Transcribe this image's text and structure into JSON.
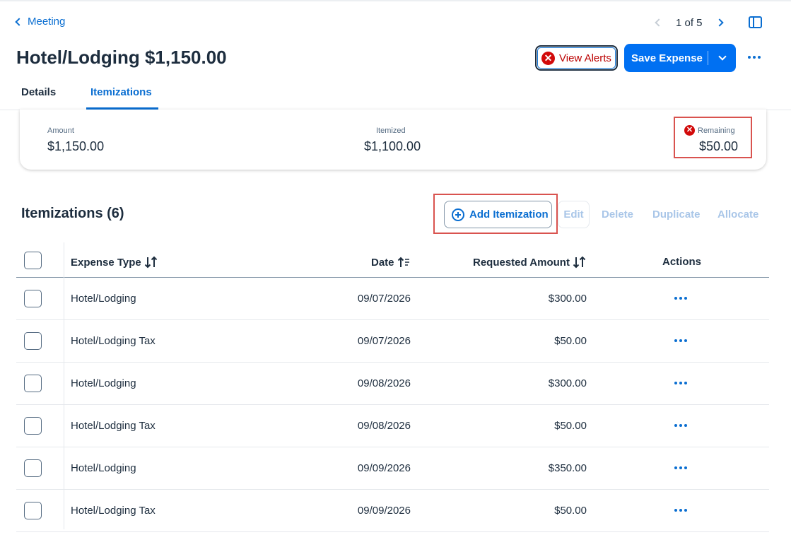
{
  "header": {
    "back_label": "Meeting",
    "pager_text": "1 of 5",
    "title": "Hotel/Lodging $1,150.00",
    "view_alerts_label": "View Alerts",
    "save_label": "Save Expense"
  },
  "tabs": [
    {
      "label": "Details",
      "active": false
    },
    {
      "label": "Itemizations",
      "active": true
    }
  ],
  "summary": {
    "amount_label": "Amount",
    "amount_value": "$1,150.00",
    "itemized_label": "Itemized",
    "itemized_value": "$1,100.00",
    "remaining_label": "Remaining",
    "remaining_value": "$50.00"
  },
  "itemizations": {
    "title": "Itemizations (6)",
    "add_label": "Add Itemization",
    "edit_label": "Edit",
    "delete_label": "Delete",
    "duplicate_label": "Duplicate",
    "allocate_label": "Allocate"
  },
  "table": {
    "columns": {
      "expense_type": "Expense Type",
      "date": "Date",
      "requested_amount": "Requested Amount",
      "actions": "Actions"
    },
    "rows": [
      {
        "expense_type": "Hotel/Lodging",
        "date": "09/07/2026",
        "amount": "$300.00"
      },
      {
        "expense_type": "Hotel/Lodging Tax",
        "date": "09/07/2026",
        "amount": "$50.00"
      },
      {
        "expense_type": "Hotel/Lodging",
        "date": "09/08/2026",
        "amount": "$300.00"
      },
      {
        "expense_type": "Hotel/Lodging Tax",
        "date": "09/08/2026",
        "amount": "$50.00"
      },
      {
        "expense_type": "Hotel/Lodging",
        "date": "09/09/2026",
        "amount": "$350.00"
      },
      {
        "expense_type": "Hotel/Lodging Tax",
        "date": "09/09/2026",
        "amount": "$50.00"
      }
    ]
  },
  "colors": {
    "accent": "#0a6ed1",
    "primary_button": "#0070f2",
    "error": "#d20a0a",
    "highlight": "#d9534f",
    "text": "#1d2d3e",
    "disabled": "#a9c6e8"
  }
}
